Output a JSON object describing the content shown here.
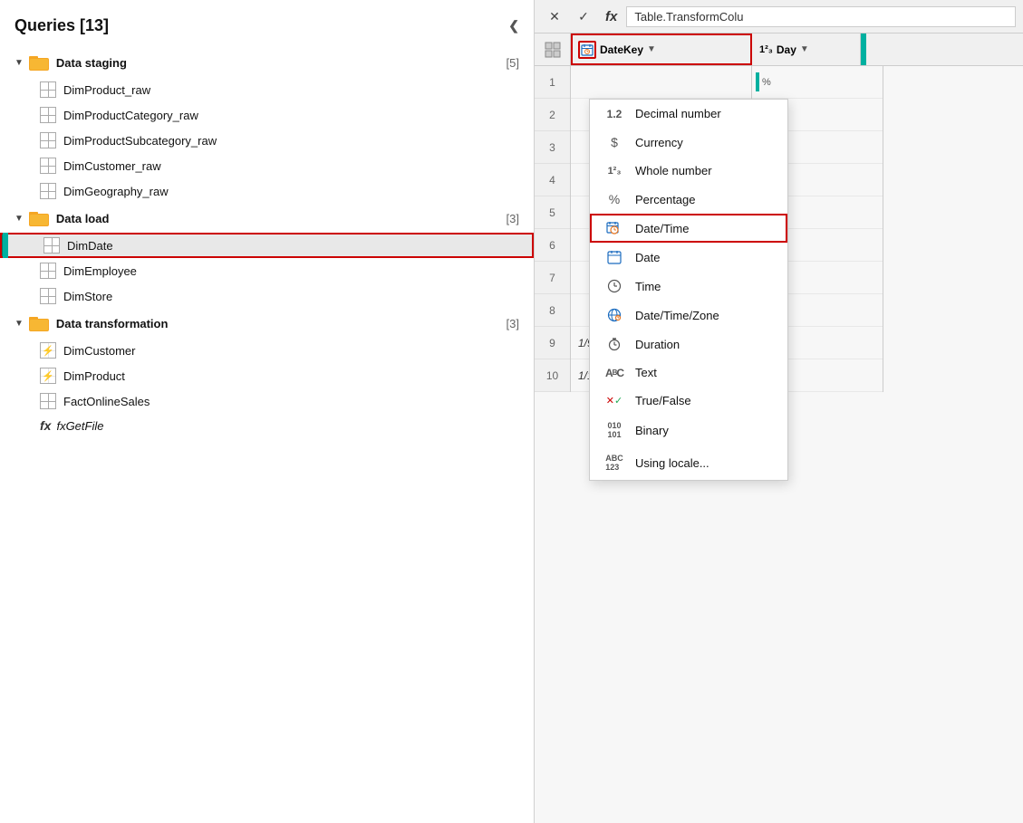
{
  "left": {
    "title": "Queries [13]",
    "collapse_label": "❮",
    "groups": [
      {
        "name": "Data staging",
        "count": "[5]",
        "items": [
          {
            "label": "DimProduct_raw",
            "type": "table"
          },
          {
            "label": "DimProductCategory_raw",
            "type": "table"
          },
          {
            "label": "DimProductSubcategory_raw",
            "type": "table"
          },
          {
            "label": "DimCustomer_raw",
            "type": "table"
          },
          {
            "label": "DimGeography_raw",
            "type": "table"
          }
        ]
      },
      {
        "name": "Data load",
        "count": "[3]",
        "items": [
          {
            "label": "DimDate",
            "type": "table",
            "active": true,
            "outlined": true
          },
          {
            "label": "DimEmployee",
            "type": "table"
          },
          {
            "label": "DimStore",
            "type": "table"
          }
        ]
      },
      {
        "name": "Data transformation",
        "count": "[3]",
        "items": [
          {
            "label": "DimCustomer",
            "type": "lightning"
          },
          {
            "label": "DimProduct",
            "type": "lightning"
          },
          {
            "label": "FactOnlineSales",
            "type": "table"
          }
        ]
      }
    ],
    "fx_item": "fxGetFile"
  },
  "right": {
    "formula_bar": {
      "cancel_label": "✕",
      "confirm_label": "✓",
      "fx_label": "fx",
      "formula_text": "Table.TransformColu"
    },
    "column_header": {
      "type_icon": "🗓",
      "col_name": "DateKey",
      "dropdown_arrow": "▼",
      "type_label": "1²₃ Day"
    },
    "dropdown": {
      "items": [
        {
          "icon": "1.2",
          "label": "Decimal number",
          "icon_type": "text"
        },
        {
          "icon": "$",
          "label": "Currency",
          "icon_type": "text"
        },
        {
          "icon": "1²₃",
          "label": "Whole number",
          "icon_type": "text"
        },
        {
          "icon": "%",
          "label": "Percentage",
          "icon_type": "text"
        },
        {
          "icon": "datetime",
          "label": "Date/Time",
          "icon_type": "datetime",
          "highlighted": true
        },
        {
          "icon": "date",
          "label": "Date",
          "icon_type": "date"
        },
        {
          "icon": "time",
          "label": "Time",
          "icon_type": "time"
        },
        {
          "icon": "globe",
          "label": "Date/Time/Zone",
          "icon_type": "globe"
        },
        {
          "icon": "stopwatch",
          "label": "Duration",
          "icon_type": "stopwatch"
        },
        {
          "icon": "ABC",
          "label": "Text",
          "icon_type": "text2"
        },
        {
          "icon": "x/check",
          "label": "True/False",
          "icon_type": "truefalse"
        },
        {
          "icon": "010101",
          "label": "Binary",
          "icon_type": "binary"
        },
        {
          "icon": "ABC123",
          "label": "Using locale...",
          "icon_type": "abcnum"
        }
      ]
    },
    "rows": [
      {
        "num": "1",
        "date": ""
      },
      {
        "num": "2",
        "date": ""
      },
      {
        "num": "3",
        "date": ""
      },
      {
        "num": "4",
        "date": ""
      },
      {
        "num": "5",
        "date": ""
      },
      {
        "num": "6",
        "date": ""
      },
      {
        "num": "7",
        "date": ""
      },
      {
        "num": "8",
        "date": ""
      },
      {
        "num": "9",
        "date": "1/9/2018"
      },
      {
        "num": "10",
        "date": "1/10/2018"
      }
    ]
  }
}
